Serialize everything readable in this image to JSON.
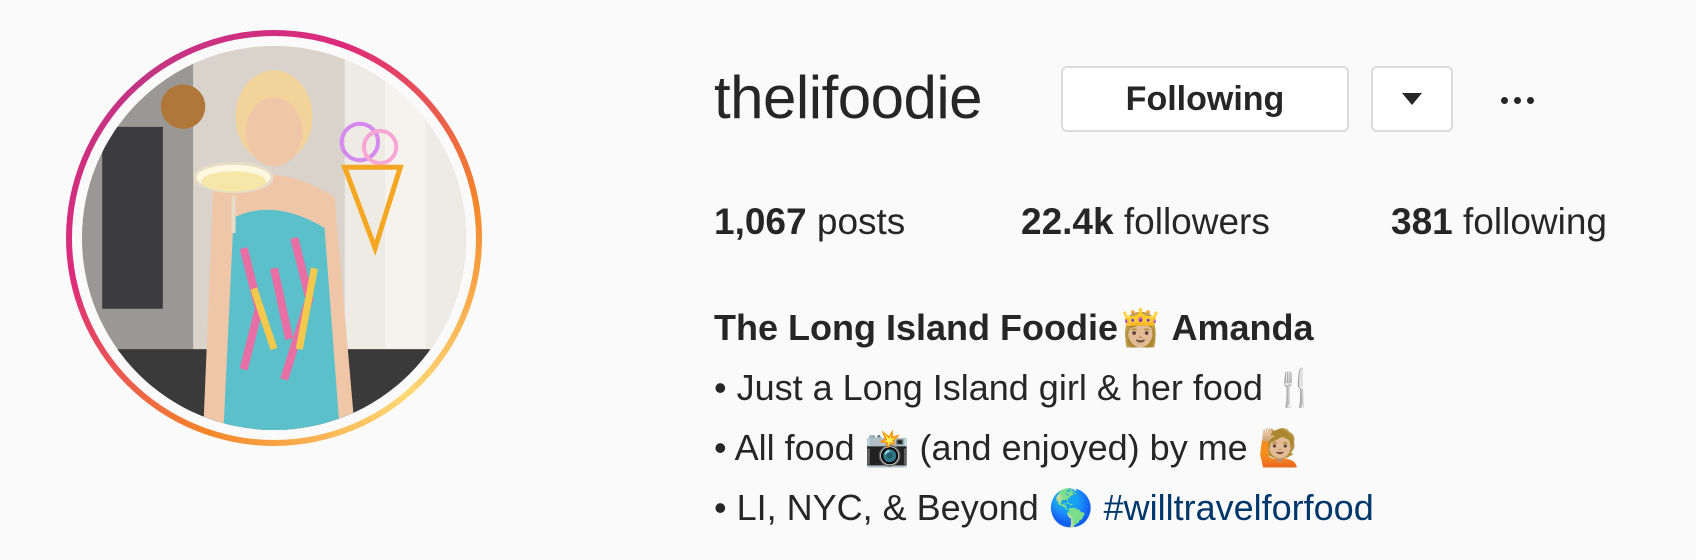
{
  "profile": {
    "username": "thelifoodie",
    "following_label": "Following",
    "stats": {
      "posts_count": "1,067",
      "posts_label": "posts",
      "followers_count": "22.4k",
      "followers_label": "followers",
      "following_count": "381",
      "following_label": "following"
    },
    "bio": {
      "name": "The Long Island Foodie👸🏼 Amanda",
      "line1": "• Just a Long Island girl & her food 🍴",
      "line2": "• All food 📸  (and enjoyed) by me 🙋🏼",
      "line3_text": "• LI, NYC, & Beyond 🌎 ",
      "line3_hashtag": "#willtravelforfood"
    }
  },
  "icons": {
    "dropdown": "caret-down-icon",
    "more": "more-options-icon",
    "avatar_ring": "story-ring"
  },
  "colors": {
    "background": "#fafafa",
    "text": "#262626",
    "button_border": "#dbdbdb",
    "hashtag": "#00376b",
    "ring_start": "#f58529",
    "ring_end": "#dd2a7b"
  }
}
